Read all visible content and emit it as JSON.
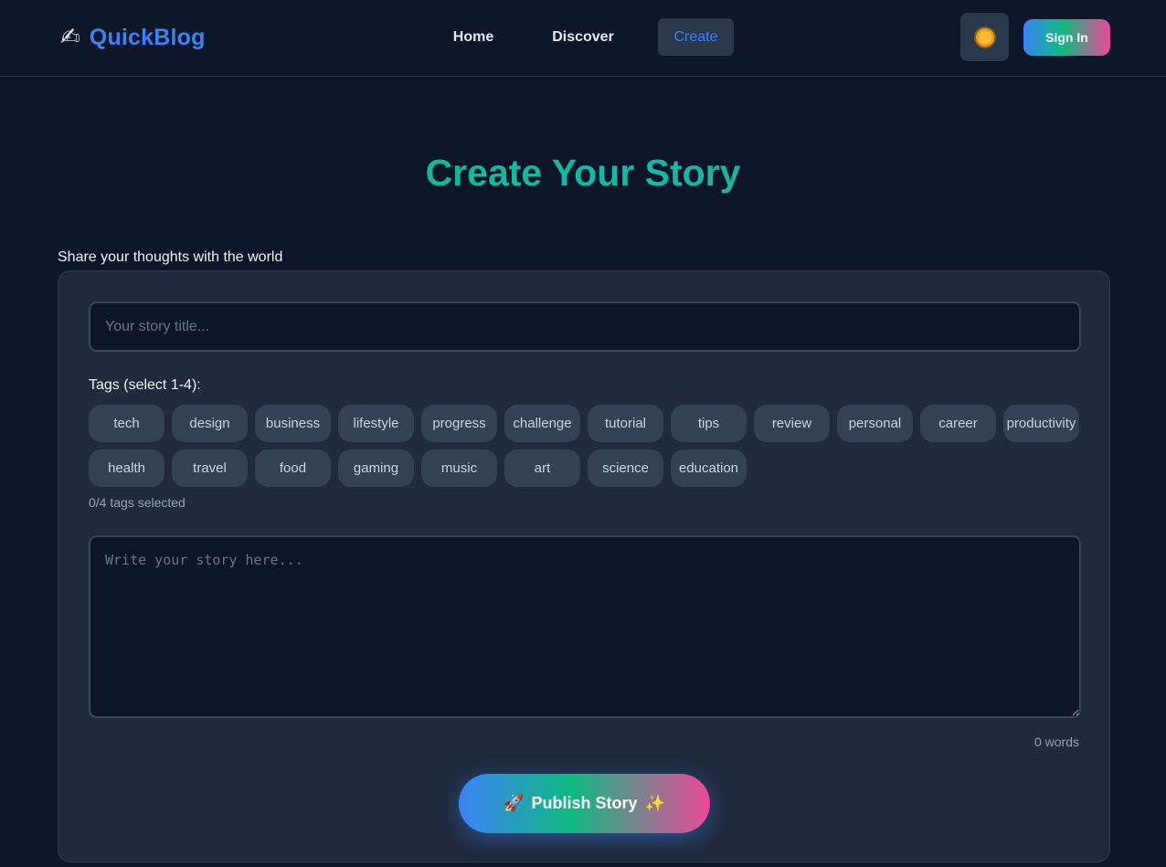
{
  "brand": {
    "icon": "✍",
    "name": "QuickBlog"
  },
  "nav": {
    "home": "Home",
    "discover": "Discover",
    "create": "Create"
  },
  "header": {
    "theme_icon": "sun-icon",
    "signin_label": "Sign In"
  },
  "page": {
    "title": "Create Your Story",
    "subtitle": "Share your thoughts with the world"
  },
  "form": {
    "title_placeholder": "Your story title...",
    "title_value": "",
    "tags_label": "Tags (select 1-4):",
    "tags": [
      "tech",
      "design",
      "business",
      "lifestyle",
      "progress",
      "challenge",
      "tutorial",
      "tips",
      "review",
      "personal",
      "career",
      "productivity",
      "health",
      "travel",
      "food",
      "gaming",
      "music",
      "art",
      "science",
      "education"
    ],
    "tags_count": "0/4 tags selected",
    "story_placeholder": "Write your story here...",
    "story_value": "",
    "word_count": "0 words",
    "publish_label": "Publish Story",
    "publish_icon_left": "🚀",
    "publish_icon_right": "✨"
  },
  "colors": {
    "accent": "#3b82f6",
    "title_gradient_start": "#10b981",
    "background": "#0d1628",
    "card": "#1f2a3c"
  }
}
